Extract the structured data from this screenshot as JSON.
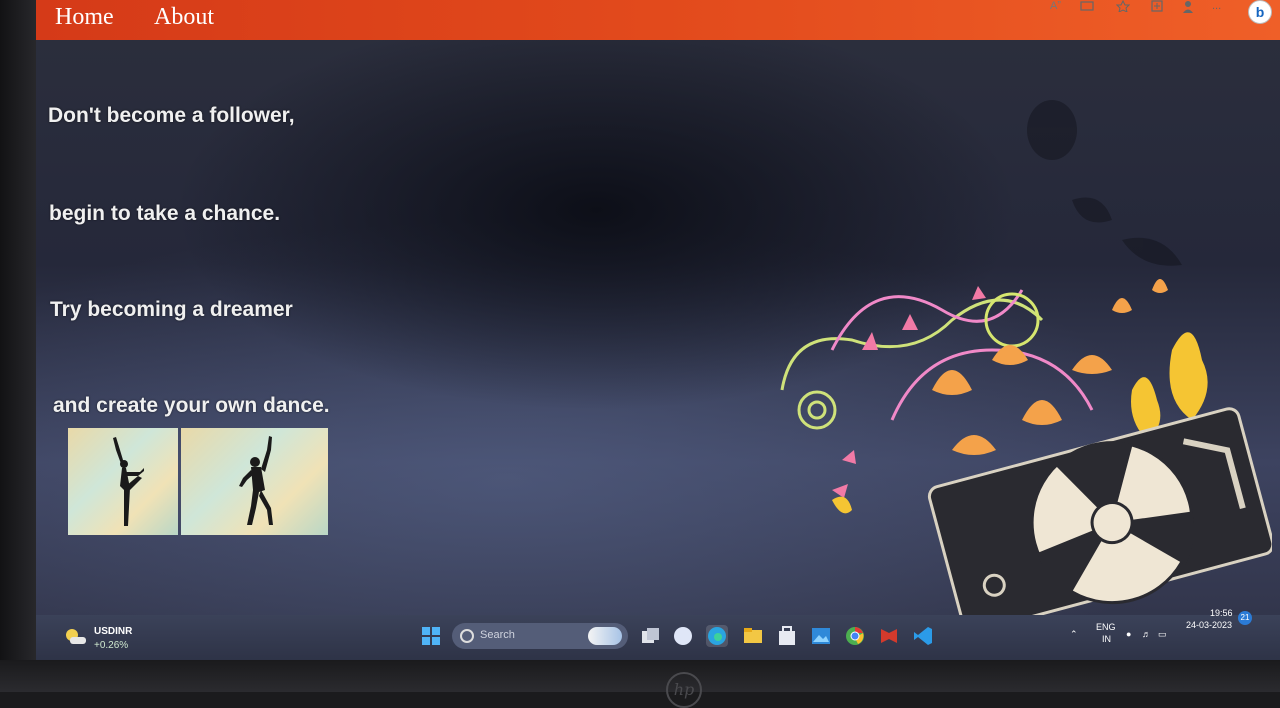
{
  "nav": {
    "home_label": "Home",
    "about_label": "About"
  },
  "quotes": [
    "Don't become a follower,",
    "begin to take a chance.",
    "Try becoming a dreamer",
    "and create your own dance."
  ],
  "images": [
    {
      "alt": "dancer-arabesque-silhouette"
    },
    {
      "alt": "dancer-pose-silhouette"
    }
  ],
  "browser_toolbar": {
    "icons": [
      "read-aloud-icon",
      "immersive-reader-icon",
      "favorites-icon",
      "collections-icon",
      "profile-icon",
      "more-icon",
      "bing-icon"
    ],
    "read_aloud": "Aˮ",
    "more": "..."
  },
  "taskbar": {
    "ticker_symbol": "USDINR",
    "ticker_change": "+0.26%",
    "search_placeholder": "Search",
    "language": "ENG",
    "region": "IN",
    "time": "19:56",
    "date": "24-03-2023",
    "notification_count": "21",
    "apps": [
      "windows-start-icon",
      "task-view-icon",
      "chat-icon",
      "edge-icon",
      "file-explorer-icon",
      "store-icon",
      "photos-icon",
      "chrome-icon",
      "mcafee-icon",
      "vscode-icon"
    ]
  },
  "colors": {
    "navbar": "#e24a1c",
    "text": "#f0f0f0",
    "taskbar": "#343a50"
  },
  "device": {
    "logo": "hp"
  }
}
